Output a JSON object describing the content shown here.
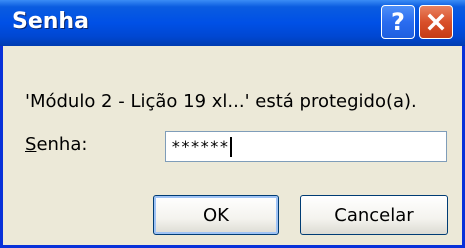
{
  "dialog": {
    "title": "Senha",
    "help_icon": "?",
    "close_icon": "close-x",
    "message": "'Módulo 2 - Lição 19 xl...' está protegido(a).",
    "password_label_accel": "S",
    "password_label_rest": "enha:",
    "password_value": "******",
    "ok_label": "OK",
    "cancel_label": "Cancelar"
  },
  "colors": {
    "titlebar": "#0054e3",
    "close_button": "#d9502a",
    "face": "#ece9d8"
  }
}
